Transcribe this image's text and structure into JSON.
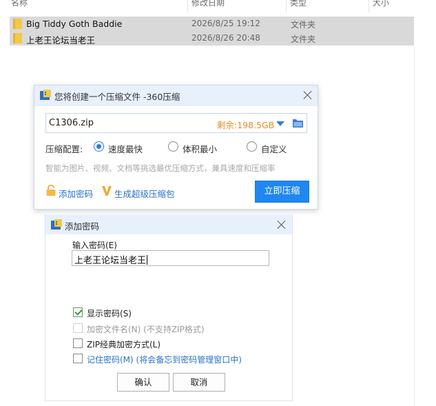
{
  "explorer": {
    "columns": {
      "name": "名称",
      "modified": "修改日期",
      "type": "类型",
      "size": "大小"
    },
    "files": [
      {
        "name": "Big Tiddy Goth Baddie",
        "modified": "2026/8/25 19:12",
        "type": "文件夹"
      },
      {
        "name": "上老王论坛当老王",
        "modified": "2026/8/26 20:48",
        "type": "文件夹"
      }
    ]
  },
  "compress_dialog": {
    "title": "您将创建一个压缩文件 -360压缩",
    "filename": "C1306.zip",
    "space_left": "剩余:198.5GB",
    "config_label": "压缩配置:",
    "options": [
      "速度最快",
      "体积最小",
      "自定义"
    ],
    "selected_option": "速度最快",
    "hint": "智能为图片、视频、文档等挑选最优压缩方式，兼具速度和压缩率",
    "add_password": "添加密码",
    "super_pack": "生成超级压缩包",
    "compress_now": "立即压缩",
    "accent_color": "#1e87f0",
    "space_color": "#f08a24"
  },
  "password_dialog": {
    "title": "添加密码",
    "input_label": "输入密码(E)",
    "password_value": "上老王论坛当老王",
    "show_password": "显示密码(S)",
    "show_password_checked": true,
    "encrypt_filenames": "加密文件名(N) (不支持ZIP格式)",
    "zip_classic": "ZIP经典加密方式(L)",
    "remember_password": "记住密码(M) (将会备忘到密码管理窗口中)",
    "ok": "确认",
    "cancel": "取消"
  },
  "icons": [
    "folder-icon",
    "app-icon",
    "close-icon",
    "dropdown-arrow-icon",
    "browse-folder-icon",
    "lock-icon",
    "v-icon",
    "checkbox-icon"
  ]
}
